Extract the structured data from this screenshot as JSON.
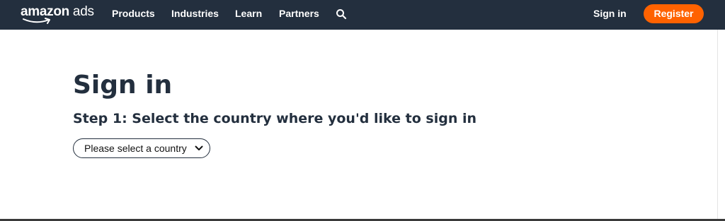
{
  "header": {
    "logo": {
      "word1": "amazon",
      "word2": " ads"
    },
    "nav": [
      {
        "label": "Products"
      },
      {
        "label": "Industries"
      },
      {
        "label": "Learn"
      },
      {
        "label": "Partners"
      }
    ],
    "search_icon": "search-icon",
    "sign_in_label": "Sign in",
    "register_label": "Register"
  },
  "main": {
    "title": "Sign in",
    "step_text": "Step 1: Select the country where you'd like to sign in",
    "country_select": {
      "selected_label": "Please select a country",
      "icon": "chevron-down-icon"
    }
  },
  "colors": {
    "header_bg": "#232f3e",
    "accent_orange": "#ff6200",
    "text_dark": "#232f3e"
  }
}
